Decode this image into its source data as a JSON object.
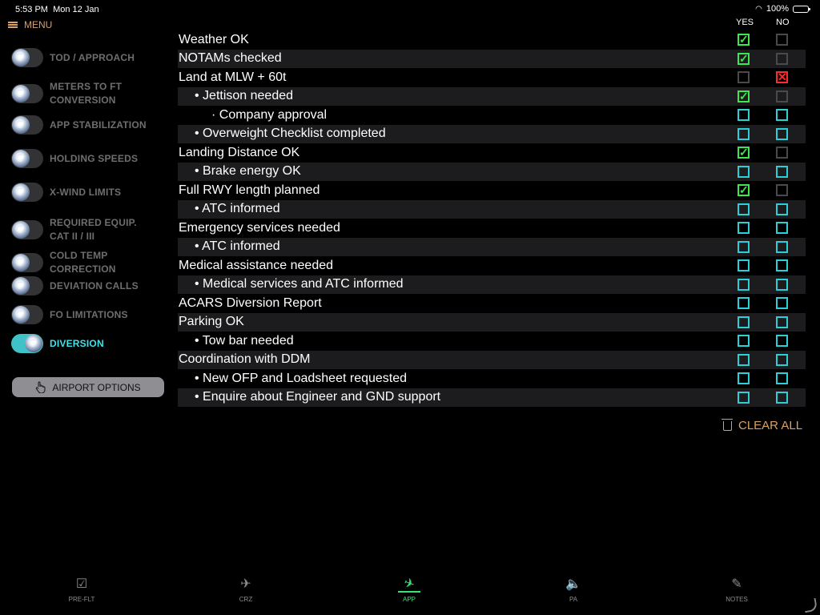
{
  "status": {
    "time": "5:53 PM",
    "date": "Mon 12 Jan",
    "battery": "100%"
  },
  "menu": {
    "label": "MENU"
  },
  "sidebar": {
    "items": [
      {
        "label": "TOD / APPROACH",
        "on": false
      },
      {
        "label": "METERS TO FT\nCONVERSION",
        "on": false
      },
      {
        "label": "APP STABILIZATION",
        "on": false
      },
      {
        "label": "HOLDING SPEEDS",
        "on": false
      },
      {
        "label": "X-WIND LIMITS",
        "on": false
      },
      {
        "label": "REQUIRED EQUIP.\nCAT II / III",
        "on": false
      },
      {
        "label": "COLD TEMP\nCORRECTION",
        "on": false
      },
      {
        "label": "DEVIATION CALLS",
        "on": false
      },
      {
        "label": "FO LIMITATIONS",
        "on": false
      },
      {
        "label": "DIVERSION",
        "on": true
      }
    ],
    "airport_options": "AIRPORT OPTIONS"
  },
  "checklist": {
    "yes_header": "YES",
    "no_header": "NO",
    "rows": [
      {
        "label": "Weather OK",
        "level": 0,
        "yes": "checked",
        "no": "grey"
      },
      {
        "label": "NOTAMs checked",
        "level": 0,
        "yes": "checked",
        "no": "grey"
      },
      {
        "label": "Land at MLW + 60t",
        "level": 0,
        "yes": "grey",
        "no": "crossed"
      },
      {
        "label": "• Jettison needed",
        "level": 1,
        "yes": "checked",
        "no": "grey"
      },
      {
        "label": "· Company approval",
        "level": 2,
        "yes": "empty",
        "no": "empty"
      },
      {
        "label": "• Overweight Checklist completed",
        "level": 1,
        "yes": "empty",
        "no": "empty"
      },
      {
        "label": "Landing Distance OK",
        "level": 0,
        "yes": "checked",
        "no": "grey"
      },
      {
        "label": "• Brake energy OK",
        "level": 1,
        "yes": "empty",
        "no": "empty"
      },
      {
        "label": "Full RWY length planned",
        "level": 0,
        "yes": "checked",
        "no": "grey"
      },
      {
        "label": "• ATC informed",
        "level": 1,
        "yes": "empty",
        "no": "empty"
      },
      {
        "label": "Emergency services needed",
        "level": 0,
        "yes": "empty",
        "no": "empty"
      },
      {
        "label": "• ATC informed",
        "level": 1,
        "yes": "empty",
        "no": "empty"
      },
      {
        "label": "Medical assistance needed",
        "level": 0,
        "yes": "empty",
        "no": "empty"
      },
      {
        "label": "• Medical services and ATC informed",
        "level": 1,
        "yes": "empty",
        "no": "empty"
      },
      {
        "label": "ACARS Diversion Report",
        "level": 0,
        "yes": "empty",
        "no": "empty"
      },
      {
        "label": "Parking OK",
        "level": 0,
        "yes": "empty",
        "no": "empty"
      },
      {
        "label": "• Tow bar needed",
        "level": 1,
        "yes": "empty",
        "no": "empty"
      },
      {
        "label": "Coordination with DDM",
        "level": 0,
        "yes": "empty",
        "no": "empty"
      },
      {
        "label": "• New OFP and Loadsheet requested",
        "level": 1,
        "yes": "empty",
        "no": "empty"
      },
      {
        "label": "• Enquire about Engineer and GND support",
        "level": 1,
        "yes": "empty",
        "no": "empty"
      }
    ],
    "clear_all": "CLEAR ALL"
  },
  "tabs": [
    {
      "label": "PRE-FLT",
      "icon": "checkbox-icon",
      "glyph": "☑",
      "active": false
    },
    {
      "label": "CRZ",
      "icon": "plane-icon",
      "glyph": "✈",
      "active": false
    },
    {
      "label": "APP",
      "icon": "landing-icon",
      "glyph": "✈",
      "active": true
    },
    {
      "label": "PA",
      "icon": "speaker-icon",
      "glyph": "🔈",
      "active": false
    },
    {
      "label": "NOTES",
      "icon": "pencil-icon",
      "glyph": "✎",
      "active": false
    }
  ]
}
